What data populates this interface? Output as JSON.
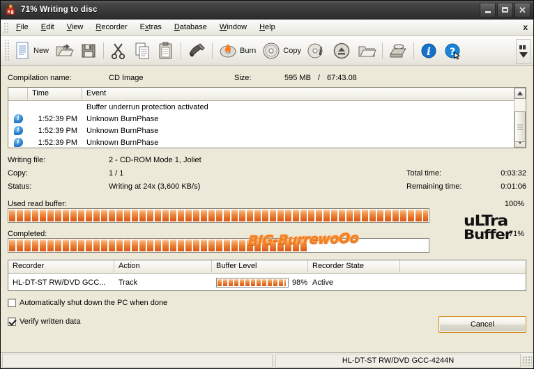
{
  "window": {
    "title": "71% Writing to disc",
    "app_icon": "nero-burning-house-icon",
    "buttons": {
      "minimize": "Minimize",
      "maximize": "Maximize",
      "close": "Close"
    }
  },
  "menubar": {
    "items": [
      {
        "label": "File",
        "accel": "F"
      },
      {
        "label": "Edit",
        "accel": "E"
      },
      {
        "label": "View",
        "accel": "V"
      },
      {
        "label": "Recorder",
        "accel": "R"
      },
      {
        "label": "Extras",
        "accel": "x"
      },
      {
        "label": "Database",
        "accel": "D"
      },
      {
        "label": "Window",
        "accel": "W"
      },
      {
        "label": "Help",
        "accel": "H"
      }
    ],
    "close_label": "x"
  },
  "toolbar": {
    "items": [
      {
        "name": "new-icon",
        "label": "New"
      },
      {
        "name": "open-icon",
        "label": ""
      },
      {
        "name": "save-icon",
        "label": ""
      },
      {
        "name": "cut-icon",
        "label": ""
      },
      {
        "name": "copy-icon",
        "label": ""
      },
      {
        "name": "paste-icon",
        "label": ""
      },
      {
        "name": "eraser-icon",
        "label": ""
      },
      {
        "name": "burn-icon",
        "label": "Burn"
      },
      {
        "name": "copy-disc-icon",
        "label": "Copy"
      },
      {
        "name": "disc-info-icon",
        "label": ""
      },
      {
        "name": "eject-icon",
        "label": ""
      },
      {
        "name": "folder-icon",
        "label": ""
      },
      {
        "name": "drive-icon",
        "label": ""
      },
      {
        "name": "info-icon",
        "label": ""
      },
      {
        "name": "help-icon",
        "label": ""
      }
    ],
    "overflow_label": "More buttons"
  },
  "compilation": {
    "label": "Compilation name:",
    "value": "CD Image",
    "size_label": "Size:",
    "size_value": "595 MB",
    "size_separator": "/",
    "size_time": "67:43.08"
  },
  "event_log": {
    "columns": [
      "",
      "Time",
      "Event"
    ],
    "rows": [
      {
        "icon": "",
        "time": "",
        "event": "Buffer underrun protection activated"
      },
      {
        "icon": "info-bubble-icon",
        "time": "1:52:39 PM",
        "event": "Unknown BurnPhase"
      },
      {
        "icon": "info-bubble-icon",
        "time": "1:52:39 PM",
        "event": "Unknown BurnPhase"
      },
      {
        "icon": "info-bubble-icon",
        "time": "1:52:39 PM",
        "event": "Unknown BurnPhase"
      }
    ]
  },
  "status": {
    "writing_file_label": "Writing file:",
    "writing_file_value": "2 - CD-ROM Mode 1, Joliet",
    "copy_label": "Copy:",
    "copy_value": "1 / 1",
    "status_label": "Status:",
    "status_value": "Writing at 24x (3,600 KB/s)",
    "total_time_label": "Total time:",
    "total_time_value": "0:03:32",
    "remaining_time_label": "Remaining time:",
    "remaining_time_value": "0:01:06",
    "watermark": "BIG-BurrewoOo"
  },
  "progress": {
    "read_buffer_label": "Used read buffer:",
    "read_buffer_percent_text": "100%",
    "read_buffer_percent": 100,
    "completed_label": "Completed:",
    "completed_percent_text": "71%",
    "completed_percent": 71,
    "logo_line1": "uLTra",
    "logo_line2": "Buffer"
  },
  "recorder_table": {
    "columns": [
      "Recorder",
      "Action",
      "Buffer Level",
      "Recorder State",
      ""
    ],
    "rows": [
      {
        "recorder": "HL-DT-ST RW/DVD GCC...",
        "action": "Track",
        "buffer_percent": 98,
        "buffer_percent_text": "98%",
        "state": "Active"
      }
    ]
  },
  "options": {
    "shutdown_label": "Automatically shut down the PC when done",
    "shutdown_checked": false,
    "verify_label": "Verify written data",
    "verify_checked": true,
    "cancel_label": "Cancel"
  },
  "statusbar": {
    "left": "",
    "right": "HL-DT-ST RW/DVD GCC-4244N"
  },
  "colors": {
    "progress_orange": "#e8762a",
    "accent_border": "#d08a18",
    "titlebar_dark": "#3a3a3a",
    "client_bg": "#ece9d8"
  }
}
